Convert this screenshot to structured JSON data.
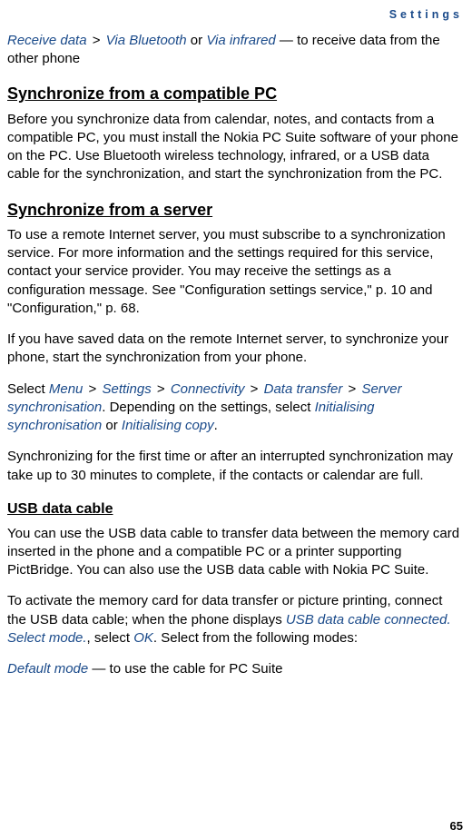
{
  "header": "Settings",
  "intro": {
    "receive_data": "Receive data",
    "via_bluetooth": "Via Bluetooth",
    "via_infrared": "Via infrared",
    "tail": " — to receive data from the other phone"
  },
  "sync_pc": {
    "heading": "Synchronize from a compatible PC",
    "body": "Before you synchronize data from calendar, notes, and contacts from a compatible PC, you must install the Nokia PC Suite software of your phone on the PC. Use Bluetooth wireless technology, infrared, or a USB data cable for the synchronization, and start the synchronization from the PC."
  },
  "sync_server": {
    "heading": "Synchronize from a server",
    "p1": "To use a remote Internet server, you must subscribe to a synchronization service. For more information and the settings required for this service, contact your service provider. You may receive the settings as a configuration message. See \"Configuration settings service,\" p. 10 and \"Configuration,\" p. 68.",
    "p2": "If you have saved data on the remote Internet server, to synchronize your phone, start the synchronization from your phone.",
    "p3_prefix": "Select ",
    "nav": {
      "menu": "Menu",
      "settings": "Settings",
      "connectivity": "Connectivity",
      "data_transfer": "Data transfer",
      "server_sync": "Server synchronisation"
    },
    "p3_mid": ". Depending on the settings, select ",
    "init_sync": "Initialising synchronisation",
    "or": " or ",
    "init_copy": "Initialising copy",
    "p3_end": ".",
    "p4": "Synchronizing for the first time or after an interrupted synchronization may take up to 30 minutes to complete, if the contacts or calendar are full."
  },
  "usb": {
    "heading": "USB data cable",
    "p1": "You can use the USB data cable to transfer data between the memory card inserted in the phone and a compatible PC or a printer supporting PictBridge. You can also use the USB data cable with Nokia PC Suite.",
    "p2_prefix": "To activate the memory card for data transfer or picture printing, connect the USB data cable; when the phone displays ",
    "connected_msg": "USB data cable connected. Select mode.",
    "p2_mid": ", select ",
    "ok": "OK",
    "p2_end": ". Select from the following modes:",
    "default_mode": "Default mode",
    "default_tail": " — to use the cable for PC Suite"
  },
  "page_number": "65"
}
